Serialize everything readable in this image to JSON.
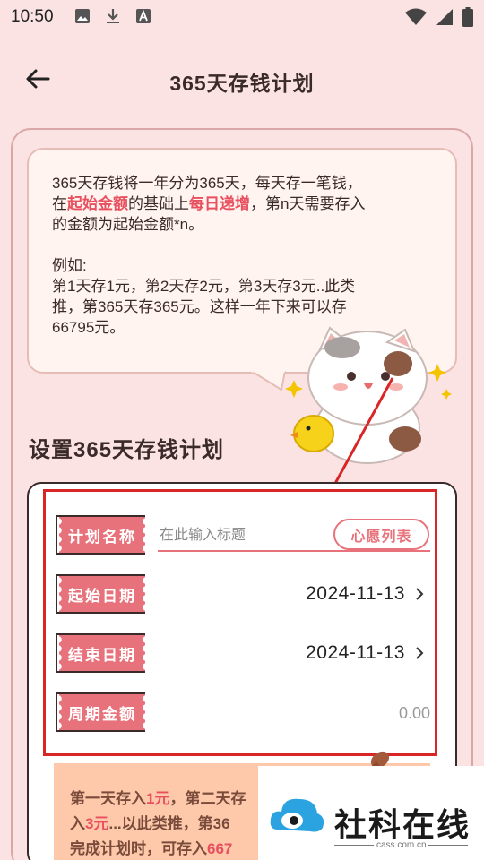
{
  "status_bar": {
    "time": "10:50",
    "left_icons": [
      "image-icon",
      "download-icon",
      "font-icon"
    ],
    "right_icons": [
      "wifi-icon",
      "signal-icon",
      "battery-icon"
    ]
  },
  "header": {
    "title": "365天存钱计划"
  },
  "intro": {
    "line1": "365天存钱将一年分为365天，每天存一笔钱，",
    "line2_prefix": "在",
    "line2_hl1": "起始金额",
    "line2_mid": "的基础上",
    "line2_hl2": "每日递增",
    "line2_suffix": "，第n天需要存入",
    "line3": "的金额为起始金额*n。",
    "example_label": "例如:",
    "ex1": "第1天存1元，第2天存2元，第3天存3元..此类",
    "ex2": "推，第365天存365元。这样一年下来可以存",
    "ex3": "66795元。"
  },
  "section_title": "设置365天存钱计划",
  "form": {
    "plan_name_label": "计划名称",
    "plan_name_placeholder": "在此输入标题",
    "wish_list_button": "心愿列表",
    "start_date_label": "起始日期",
    "start_date_value": "2024-11-13",
    "end_date_label": "结束日期",
    "end_date_value": "2024-11-13",
    "period_amount_label": "周期金额",
    "period_amount_value": "0.00"
  },
  "tip": {
    "l1_a": "第一天存入",
    "l1_hl": "1元",
    "l1_b": "，第二天存",
    "l2_a": "入",
    "l2_hl": "3元",
    "l2_b": "...以此类推，第36",
    "l3_a": "完成计划时，可存入",
    "l3_hl": "667"
  },
  "watermark": {
    "name": "社科在线",
    "url": "cass.com.cn"
  },
  "colors": {
    "background": "#fbe3e3",
    "accent": "#e8727b",
    "highlight": "#e9505f",
    "annotation_red": "#d92525"
  }
}
